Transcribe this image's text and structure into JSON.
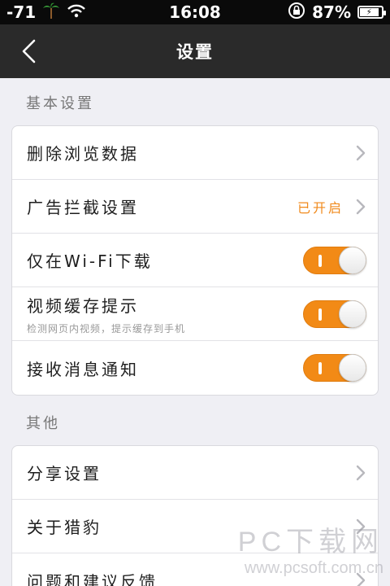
{
  "status_bar": {
    "signal": "-71",
    "time": "16:08",
    "battery": "87%",
    "icons": [
      "palm-tree-icon",
      "wifi-icon",
      "rotation-lock-icon",
      "battery-charging-icon"
    ]
  },
  "nav": {
    "title": "设置",
    "back_icon": "chevron-left-icon"
  },
  "sections": {
    "basic": {
      "label": "基本设置",
      "rows": {
        "clear_data": {
          "label": "删除浏览数据"
        },
        "ad_block": {
          "label": "广告拦截设置",
          "value": "已开启"
        },
        "wifi_only": {
          "label": "仅在Wi-Fi下载",
          "on": true
        },
        "video_cache": {
          "label": "视频缓存提示",
          "sub": "检测网页内视频，提示缓存到手机",
          "on": true
        },
        "notifications": {
          "label": "接收消息通知",
          "on": true
        }
      }
    },
    "other": {
      "label": "其他",
      "rows": {
        "share": {
          "label": "分享设置"
        },
        "about": {
          "label": "关于猎豹"
        },
        "feedback": {
          "label": "问题和建议反馈"
        }
      }
    }
  },
  "colors": {
    "accent": "#f28a16",
    "nav_bg": "#2a2a2a",
    "page_bg": "#efeff4"
  },
  "watermark": {
    "big": "PC下载网",
    "small": "www.pcsoft.com.cn"
  }
}
